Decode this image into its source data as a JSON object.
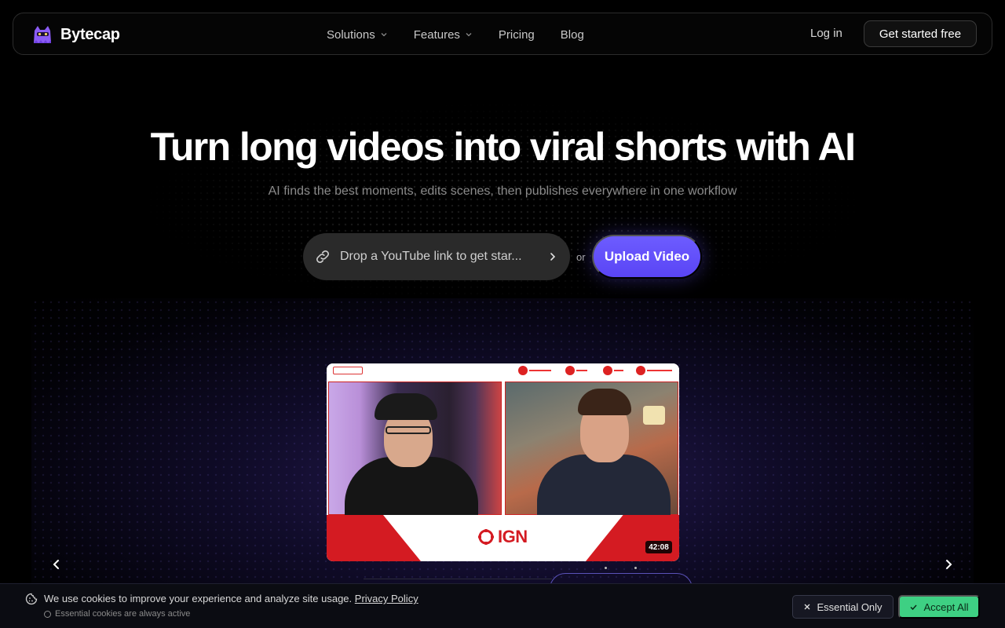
{
  "brand": {
    "name": "Bytecap",
    "accent": "#8b5cf6"
  },
  "nav": {
    "items": [
      {
        "label": "Solutions",
        "has_dropdown": true
      },
      {
        "label": "Features",
        "has_dropdown": true
      },
      {
        "label": "Pricing",
        "has_dropdown": false
      },
      {
        "label": "Blog",
        "has_dropdown": false
      }
    ],
    "login_label": "Log in",
    "cta_label": "Get started free"
  },
  "hero": {
    "title": "Turn long videos into viral shorts with AI",
    "subtitle": "AI finds the best moments, edits scenes, then publishes everywhere in one workflow",
    "input_placeholder": "Drop a YouTube link to get star...",
    "or_label": "or",
    "upload_label": "Upload Video",
    "upload_color": "#6a58ff"
  },
  "video": {
    "logo_text": "IGN",
    "duration": "42:08",
    "brand_color": "#d41b22"
  },
  "carousel": {
    "prev_icon": "chevron-left-icon",
    "next_icon": "chevron-right-icon"
  },
  "cookie": {
    "message": "We use cookies to improve your experience and analyze site usage.",
    "policy_link": "Privacy Policy",
    "note": "Essential cookies are always active",
    "essential_label": "Essential Only",
    "accept_label": "Accept All",
    "accept_color": "#3ed083"
  }
}
